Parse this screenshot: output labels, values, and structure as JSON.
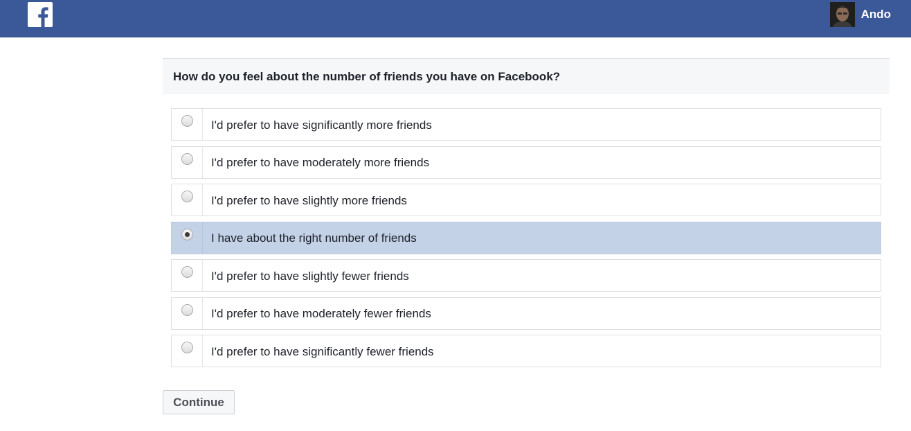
{
  "header": {
    "logo_icon": "facebook-f-icon",
    "user_name": "Ando",
    "bar_color": "#3b5998"
  },
  "survey": {
    "question": "How do you feel about the number of friends you have on Facebook?",
    "options": [
      {
        "label": "I'd prefer to have significantly more friends",
        "selected": false
      },
      {
        "label": "I'd prefer to have moderately more friends",
        "selected": false
      },
      {
        "label": "I'd prefer to have slightly more friends",
        "selected": false
      },
      {
        "label": "I have about the right number of friends",
        "selected": true
      },
      {
        "label": "I'd prefer to have slightly fewer friends",
        "selected": false
      },
      {
        "label": "I'd prefer to have moderately fewer friends",
        "selected": false
      },
      {
        "label": "I'd prefer to have significantly fewer friends",
        "selected": false
      }
    ],
    "selected_highlight_color": "#c4d2e7"
  },
  "actions": {
    "continue_label": "Continue"
  }
}
